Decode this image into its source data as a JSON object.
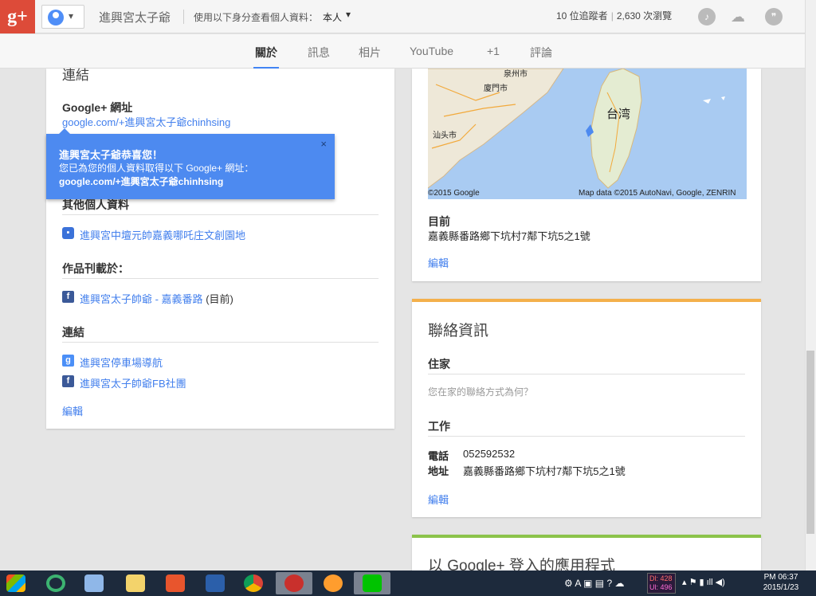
{
  "header": {
    "logo": "g+",
    "page_name": "進興宮太子爺",
    "view_as_label": "使用以下身分查看個人資料：",
    "view_as_value": "本人",
    "followers": "10 位追蹤者",
    "views": "2,630 次瀏覽"
  },
  "tabs": [
    {
      "label": "關於"
    },
    {
      "label": "訊息"
    },
    {
      "label": "相片"
    },
    {
      "label": "YouTube"
    },
    {
      "label": "+1"
    },
    {
      "label": "評論"
    }
  ],
  "left_card": {
    "links_title": "連結",
    "gplus_url_label": "Google+ 網址",
    "gplus_url": "google.com/+進興宮太子爺chinhsing",
    "other_profiles_title": "其他個人資料",
    "other_profile_item": "進興宮中壇元帥嘉義哪吒庄文創園地",
    "contributor_title": "作品刊載於：",
    "contributor_item": "進興宮太子帥爺 - 嘉義番路",
    "contributor_suffix": "(目前)",
    "links_section_title": "連結",
    "link_items": [
      "進興宮停車場導航",
      "進興宮太子帥爺FB社團"
    ],
    "edit": "編輯"
  },
  "popup": {
    "title": "進興宮太子爺恭喜您！",
    "body": "您已為您的個人資料取得以下 Google+ 網址：",
    "url": "google.com/+進興宮太子爺chinhsing",
    "close": "×"
  },
  "map": {
    "labels": [
      "泉州市",
      "廈門市",
      "汕头市",
      "台湾"
    ],
    "copyright_left": "©2015 Google",
    "copyright_right": "Map data ©2015 AutoNavi, Google, ZENRIN"
  },
  "location": {
    "label": "目前",
    "address": "嘉義縣番路鄉下坑村7鄰下坑5之1號",
    "edit": "編輯"
  },
  "contact": {
    "title": "聯絡資訊",
    "home_label": "住家",
    "home_placeholder": "您在家的聯絡方式為何？",
    "work_label": "工作",
    "phone_label": "電話",
    "phone": "052592532",
    "address_label": "地址",
    "address": "嘉義縣番路鄉下坑村7鄰下坑5之1號",
    "edit": "編輯"
  },
  "apps_card": {
    "title": "以 Google+ 登入的應用程式"
  },
  "taskbar": {
    "dl_rate": "Dl: 428",
    "ul_rate": "Ul: 496",
    "time": "PM 06:37",
    "date": "2015/1/23"
  },
  "colors": {
    "gplus_red": "#dd4b39",
    "link_blue": "#427fed",
    "popup_blue": "#4d8af0",
    "contact_accent": "#f4b04b",
    "apps_accent": "#8bc34a"
  }
}
